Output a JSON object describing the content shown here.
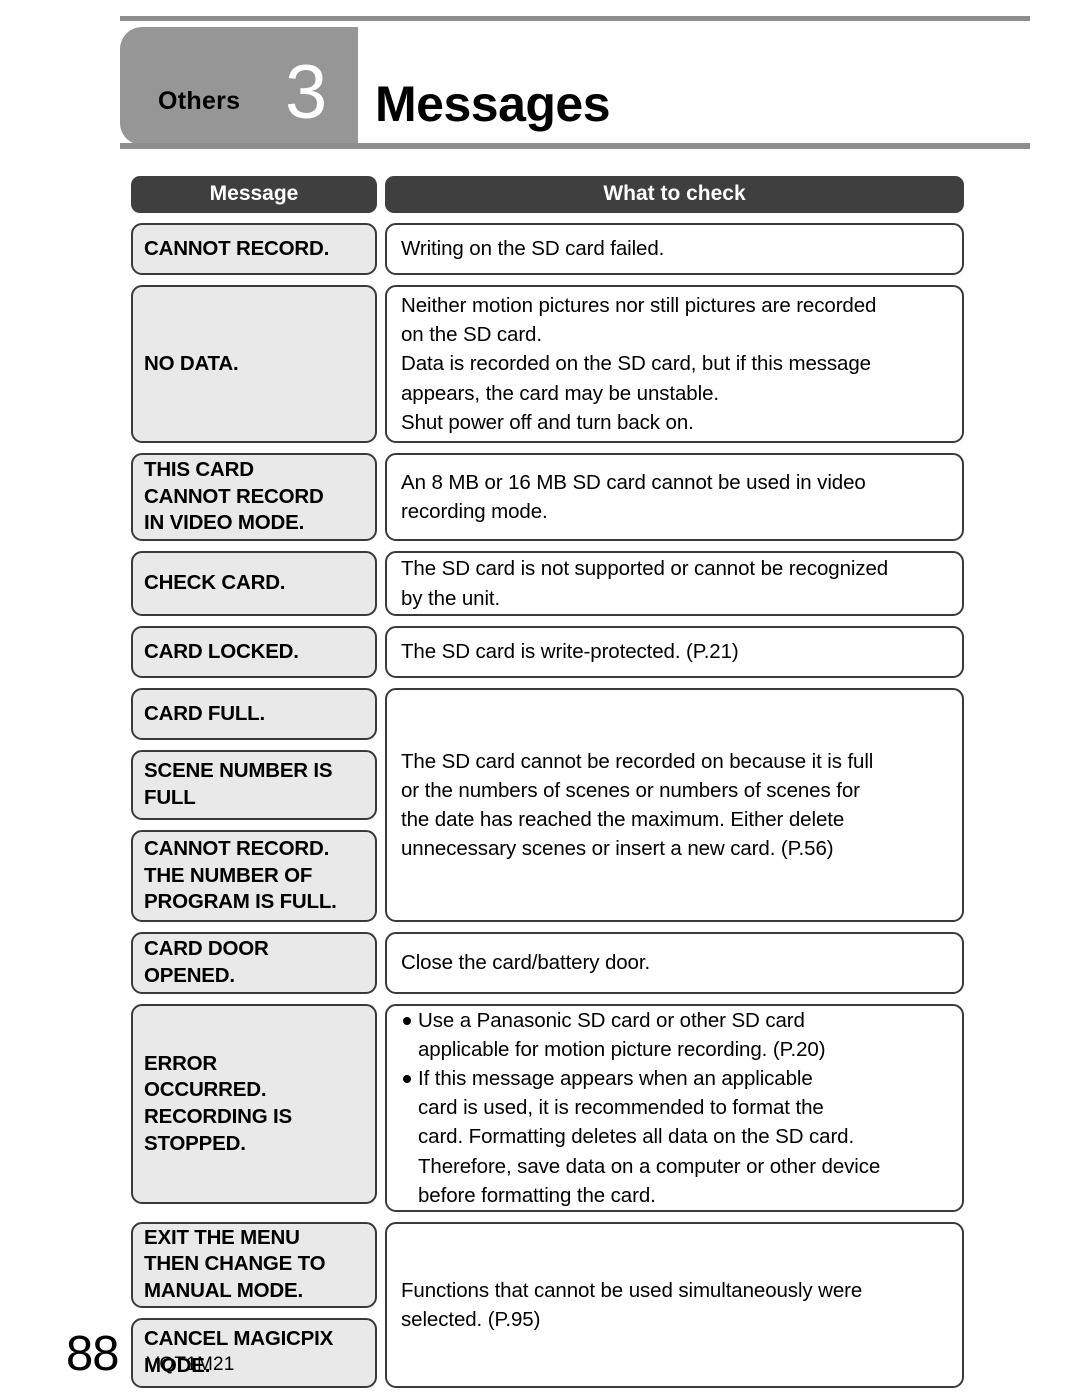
{
  "header": {
    "chapter_label": "Others",
    "chapter_number": "3",
    "title": "Messages"
  },
  "table": {
    "columns": [
      "Message",
      "What to check"
    ],
    "groups": [
      {
        "messages": [
          "CANNOT RECORD."
        ],
        "checks": [
          {
            "type": "lines",
            "lines": [
              "Writing on the SD card failed."
            ]
          }
        ]
      },
      {
        "messages": [
          "NO DATA."
        ],
        "checks": [
          {
            "type": "lines",
            "lines": [
              "Neither motion pictures nor still pictures are recorded",
              "on the SD card.",
              "Data is recorded on the SD card, but if this message",
              "appears, the card may be unstable.",
              "Shut power off and turn back on."
            ]
          }
        ]
      },
      {
        "messages": [
          "THIS CARD\nCANNOT RECORD\nIN VIDEO MODE."
        ],
        "checks": [
          {
            "type": "lines",
            "lines": [
              "An 8 MB or 16 MB SD card cannot be used in video",
              "recording mode."
            ]
          }
        ]
      },
      {
        "messages": [
          "CHECK CARD."
        ],
        "checks": [
          {
            "type": "lines",
            "lines": [
              "The SD card is not supported or cannot be recognized",
              "by the unit."
            ]
          }
        ]
      },
      {
        "messages": [
          "CARD LOCKED."
        ],
        "checks": [
          {
            "type": "lines",
            "lines": [
              "The SD card is write-protected. (P.21)"
            ]
          }
        ]
      },
      {
        "messages": [
          "CARD FULL.",
          "SCENE NUMBER IS\nFULL",
          "CANNOT RECORD.\nTHE NUMBER OF\nPROGRAM IS FULL."
        ],
        "checks": [
          {
            "type": "lines",
            "lines": [
              "The SD card cannot be recorded on because it is full",
              "or the numbers of scenes or numbers of scenes for",
              "the date has reached the maximum. Either delete",
              "unnecessary scenes or insert a new card. (P.56)"
            ]
          }
        ]
      },
      {
        "messages": [
          "CARD DOOR\nOPENED."
        ],
        "checks": [
          {
            "type": "lines",
            "lines": [
              "Close the card/battery door."
            ]
          }
        ]
      },
      {
        "messages": [
          "ERROR\nOCCURRED.\nRECORDING IS\nSTOPPED."
        ],
        "checks": [
          {
            "type": "bullets",
            "items": [
              [
                "Use a Panasonic SD card or other SD card",
                "applicable for motion picture recording. (P.20)"
              ],
              [
                "If this message appears when an applicable",
                "card is used, it is recommended to format the",
                "card. Formatting deletes all data on the SD card.",
                "Therefore, save data on a computer or other device",
                "before formatting the card."
              ]
            ]
          }
        ]
      },
      {
        "messages": [
          "EXIT THE MENU\nTHEN CHANGE TO\nMANUAL MODE.",
          "CANCEL MAGICPIX\nMODE."
        ],
        "checks": [
          {
            "type": "lines",
            "lines": [
              "Functions that cannot be used simultaneously were",
              "selected. (P.95)"
            ]
          }
        ]
      }
    ]
  },
  "footer": {
    "page_number": "88",
    "document_code": "VQT1M21"
  },
  "colors": {
    "chapter_tab": "#969696",
    "rule": "#8e8e8e",
    "header_cell": "#3f3f3f",
    "message_cell": "#e9e9e9",
    "border": "#3a3a3a"
  }
}
